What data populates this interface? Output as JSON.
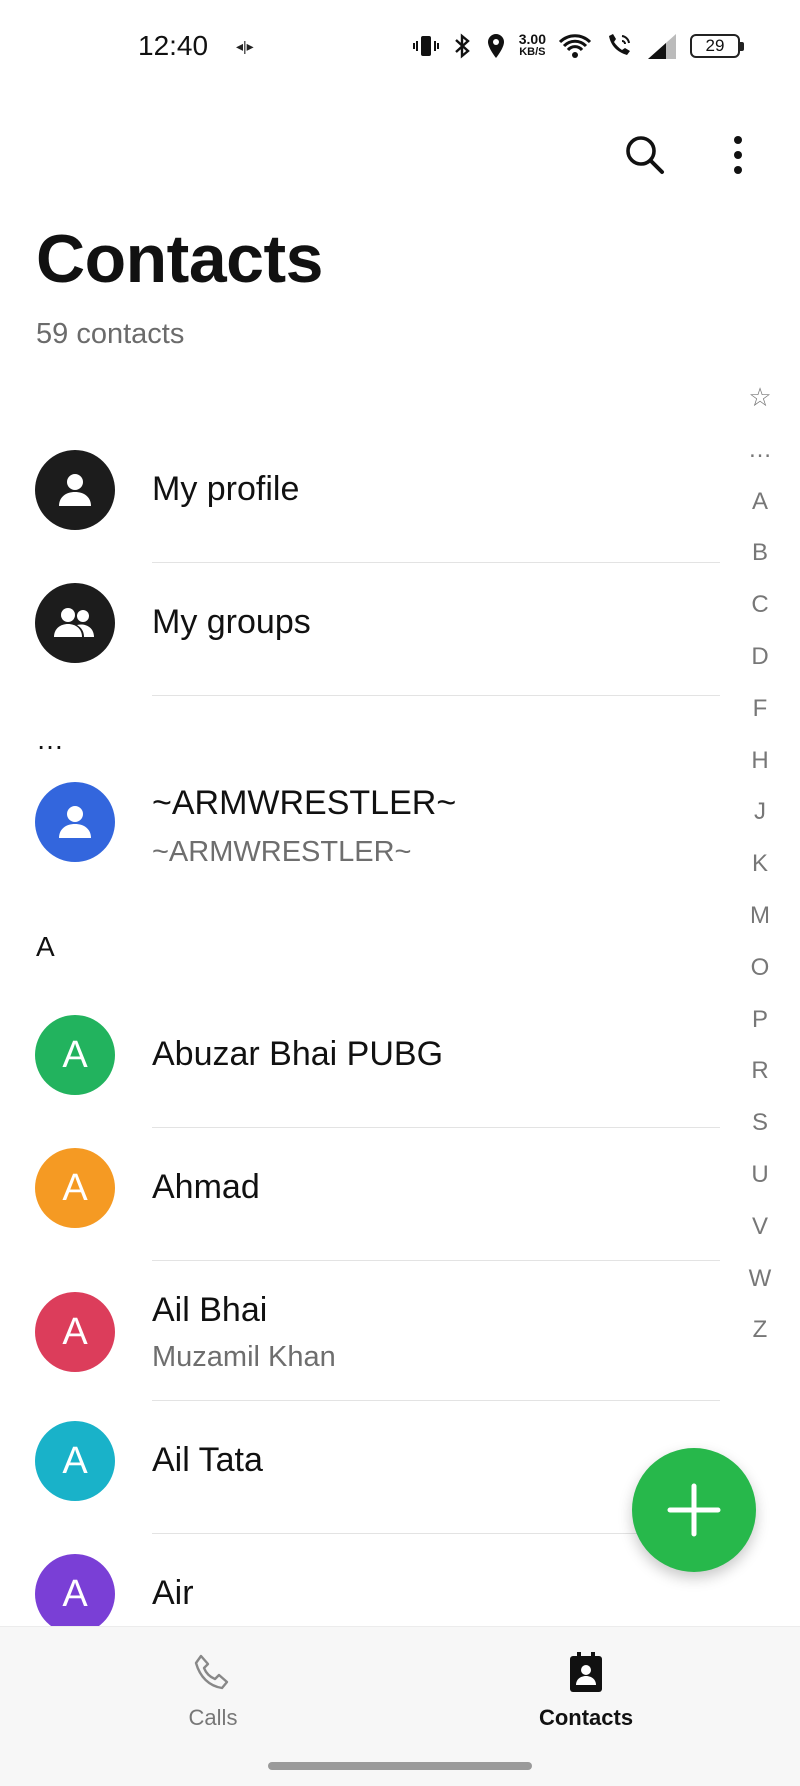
{
  "status_bar": {
    "time": "12:40",
    "network_speed_value": "3.00",
    "network_speed_unit": "KB/S",
    "battery": "29",
    "icons": [
      "vibrate-icon",
      "bluetooth-icon",
      "location-icon",
      "wifi-icon",
      "wifi-call-icon",
      "signal-icon"
    ]
  },
  "header": {
    "title": "Contacts",
    "count": "59 contacts",
    "actions": [
      "search-icon",
      "more-options-icon"
    ]
  },
  "alpha_index": [
    "☆",
    "…",
    "A",
    "B",
    "C",
    "D",
    "F",
    "H",
    "J",
    "K",
    "M",
    "O",
    "P",
    "R",
    "S",
    "U",
    "V",
    "W",
    "Z"
  ],
  "quick_items": [
    {
      "label": "My profile",
      "icon": "person-icon"
    },
    {
      "label": "My groups",
      "icon": "group-icon"
    }
  ],
  "sections": [
    {
      "header": "…",
      "contacts": [
        {
          "name": "~ARMWRESTLER~",
          "sub": "~ARMWRESTLER~",
          "avatar": "",
          "color": "#3366dd"
        }
      ]
    },
    {
      "header": "A",
      "contacts": [
        {
          "name": "Abuzar Bhai PUBG",
          "sub": "",
          "avatar": "A",
          "color": "#22b35e"
        },
        {
          "name": "Ahmad",
          "sub": "",
          "avatar": "A",
          "color": "#f59a23"
        },
        {
          "name": "Ail Bhai",
          "sub": "Muzamil Khan",
          "avatar": "A",
          "color": "#dc3d5b"
        },
        {
          "name": "Ail Tata",
          "sub": "",
          "avatar": "A",
          "color": "#19b2c9"
        },
        {
          "name": "Air",
          "sub": "",
          "avatar": "A",
          "color": "#7a3fd6"
        }
      ]
    }
  ],
  "fab": {
    "icon": "add-icon",
    "color": "#27b84b"
  },
  "bottom_nav": {
    "calls_label": "Calls",
    "contacts_label": "Contacts",
    "active": "Contacts"
  }
}
